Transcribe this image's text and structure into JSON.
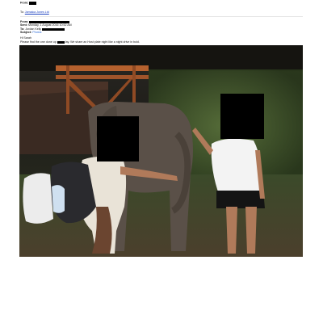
{
  "email": {
    "from_label": "From:",
    "to_label": "To:",
    "to_link": "Jamaica Jones Ltd",
    "header": {
      "sent_label": "Sent:",
      "sent_value": "Monday, 1 August 2016 10:52 AM",
      "to_label": "To:",
      "to_value": "Jordan Kelly",
      "subject_label": "Subject:",
      "subject_value": "Photos"
    },
    "greeting": "Hi Sarah",
    "body_start": "Please find the one done up",
    "body_end": "lay. We share an Host plate night like a night drive in bold."
  },
  "photo": {
    "background_color": "#1d1c17",
    "skin_color": "#b07a5a",
    "elephant_color": "#5a5048"
  }
}
